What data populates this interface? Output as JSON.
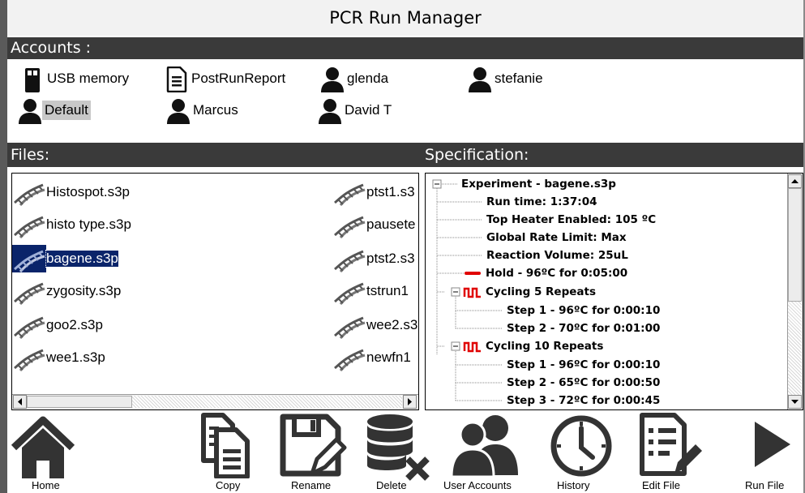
{
  "window": {
    "title": "PCR Run Manager"
  },
  "accounts": {
    "header": "Accounts :",
    "items": [
      {
        "label": "USB memory",
        "icon": "usb-icon"
      },
      {
        "label": "PostRunReport",
        "icon": "document-icon"
      },
      {
        "label": "glenda",
        "icon": "user-icon"
      },
      {
        "label": "stefanie",
        "icon": "user-icon"
      },
      {
        "label": "Default",
        "icon": "user-icon",
        "selected": true
      },
      {
        "label": "Marcus",
        "icon": "user-icon"
      },
      {
        "label": "David T",
        "icon": "user-icon"
      }
    ]
  },
  "files": {
    "header": "Files:",
    "items": [
      {
        "label": "Histospot.s3p"
      },
      {
        "label": "histo type.s3p"
      },
      {
        "label": "bagene.s3p",
        "selected": true
      },
      {
        "label": "zygosity.s3p"
      },
      {
        "label": "goo2.s3p"
      },
      {
        "label": "wee1.s3p"
      },
      {
        "label": "ptst1.s3"
      },
      {
        "label": "pausete"
      },
      {
        "label": "ptst2.s3"
      },
      {
        "label": "tstrun1"
      },
      {
        "label": "wee2.s3"
      },
      {
        "label": "newfn1"
      }
    ]
  },
  "spec": {
    "header": "Specification:",
    "experiment": "Experiment - bagene.s3p",
    "run_time": "Run time: 1:37:04",
    "top_heater": "Top Heater Enabled: 105 ºC",
    "rate_limit": "Global Rate Limit: Max",
    "reaction_volume": "Reaction Volume: 25uL",
    "hold": "Hold - 96ºC for 0:05:00",
    "cycling1": "Cycling 5 Repeats",
    "c1_step1": "Step 1 - 96ºC for 0:00:10",
    "c1_step2": "Step 2 - 70ºC for 0:01:00",
    "cycling2": "Cycling 10 Repeats",
    "c2_step1": "Step 1 - 96ºC for 0:00:10",
    "c2_step2": "Step 2 - 65ºC for 0:00:50",
    "c2_step3": "Step 3 - 72ºC for 0:00:45"
  },
  "toolbar": {
    "home": "Home",
    "copy": "Copy",
    "rename": "Rename",
    "delete": "Delete",
    "user_accounts": "User Accounts",
    "history": "History",
    "edit_file": "Edit File",
    "run_file": "Run File"
  },
  "colors": {
    "section_bar": "#3a3a3a",
    "selection": "#0a246a",
    "hold_marker": "#e00000"
  }
}
